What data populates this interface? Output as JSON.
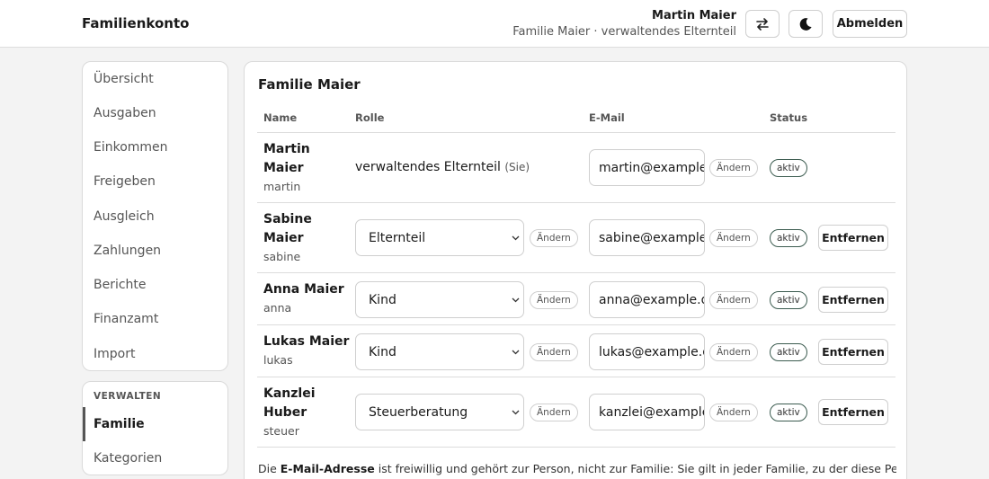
{
  "header": {
    "app_title": "Familienkonto",
    "user_name": "Martin Maier",
    "user_context": "Familie Maier · verwaltendes Elternteil",
    "logout_label": "Abmelden"
  },
  "sidebar": {
    "items": [
      "Übersicht",
      "Ausgaben",
      "Einkommen",
      "Freigeben",
      "Ausgleich",
      "Zahlungen",
      "Berichte",
      "Finanzamt",
      "Import"
    ],
    "admin_heading": "VERWALTEN",
    "admin_items": [
      "Familie",
      "Kategorien"
    ]
  },
  "main": {
    "title": "Familie Maier",
    "columns": {
      "name": "Name",
      "role": "Rolle",
      "email": "E-Mail",
      "status": "Status"
    },
    "change_label": "Ändern",
    "remove_label": "Entfernen",
    "members": [
      {
        "name": "Martin Maier",
        "username": "martin",
        "role": "verwaltendes Elternteil",
        "role_suffix": "(Sie)",
        "email": "martin@example.de",
        "status": "aktiv"
      },
      {
        "name": "Sabine Maier",
        "username": "sabine",
        "role": "Elternteil",
        "email": "sabine@example.de",
        "status": "aktiv"
      },
      {
        "name": "Anna Maier",
        "username": "anna",
        "role": "Kind",
        "email": "anna@example.de",
        "status": "aktiv"
      },
      {
        "name": "Lukas Maier",
        "username": "lukas",
        "role": "Kind",
        "email": "lukas@example.de",
        "status": "aktiv"
      },
      {
        "name": "Kanzlei Huber",
        "username": "steuer",
        "role": "Steuerberatung",
        "email": "kanzlei@example.de",
        "status": "aktiv"
      }
    ],
    "footnote_prefix": "Die ",
    "footnote_bold": "E-Mail-Adresse",
    "footnote_rest": " ist freiwillig und gehört zur Person, nicht zur Familie: Sie gilt in jeder Familie, zu der diese Person gehört."
  }
}
